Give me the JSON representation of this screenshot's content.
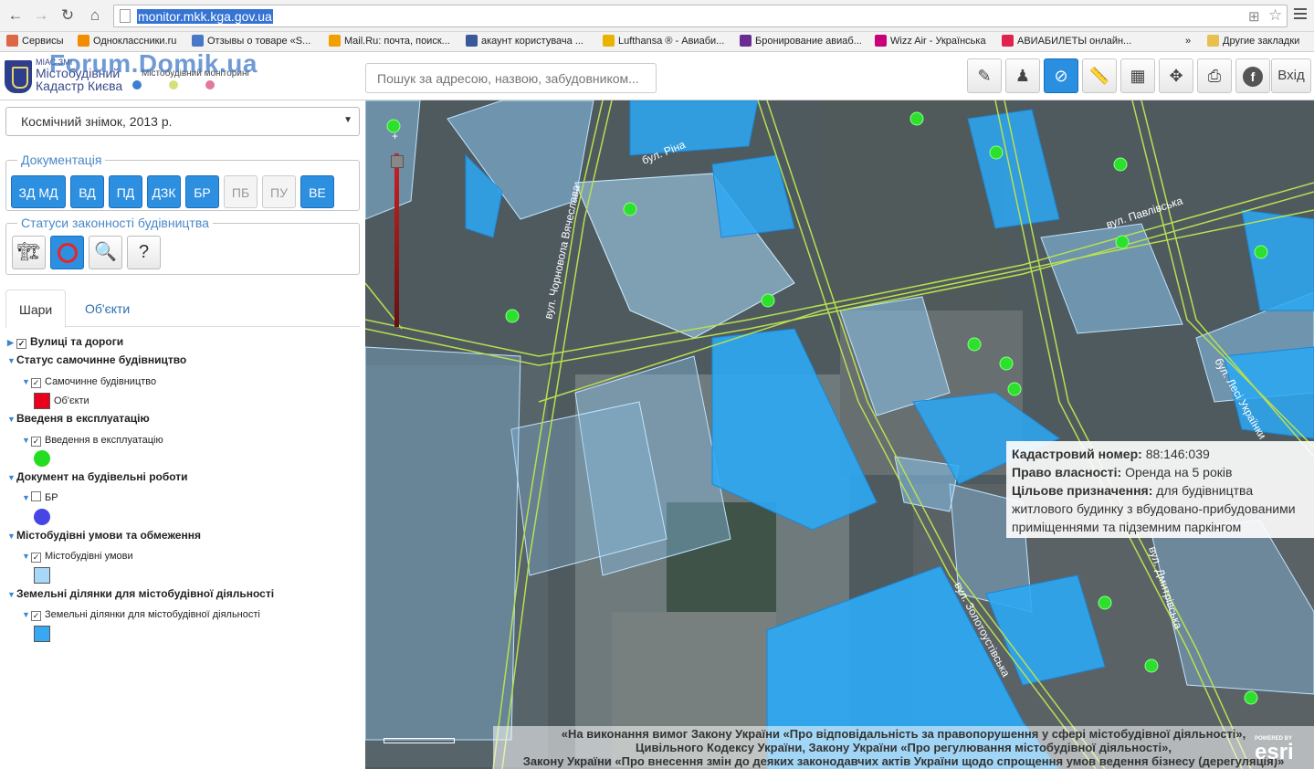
{
  "browser": {
    "url": "monitor.mkk.kga.gov.ua",
    "bookmarks": [
      {
        "label": "Сервисы",
        "color": "#d64",
        "icon": "apps-icon"
      },
      {
        "label": "Одноклассники.ru",
        "color": "#f28c00",
        "icon": "ok-icon"
      },
      {
        "label": "Отзывы о товаре «S...",
        "color": "#4a78c8",
        "icon": "doc-icon"
      },
      {
        "label": "Mail.Ru: почта, поиск...",
        "color": "#f0a000",
        "icon": "mail-icon"
      },
      {
        "label": "акаунт користувача ...",
        "color": "#3b5998",
        "icon": "dots-icon"
      },
      {
        "label": "Lufthansa ® - Авиаби...",
        "color": "#e8b400",
        "icon": "lufthansa-icon"
      },
      {
        "label": "Бронирование авиаб...",
        "color": "#6b2c91",
        "icon": "booking-icon"
      },
      {
        "label": "Wizz Air - Українська",
        "color": "#c8007a",
        "icon": "wizz-icon"
      },
      {
        "label": "АВИАБИЛЕТЫ онлайн...",
        "color": "#e0224c",
        "icon": "avia-icon"
      }
    ],
    "more": "»",
    "other_bookmarks": "Другие закладки"
  },
  "app": {
    "miac": "МІАС ЗМІ",
    "title_line1": "Містобудівний",
    "title_line2": "Кадастр Києва",
    "subtitle": "Містобудівний моніторинг",
    "watermark": "Forum.Domik.ua",
    "dots": [
      "#3a7fd0",
      "#d6e07a",
      "#e07a98"
    ],
    "search_placeholder": "Пошук за адресою, назвою, забудовником...",
    "exit_label": "Вхід",
    "tools": [
      {
        "name": "edit-tool-button",
        "icon": "✎",
        "active": false
      },
      {
        "name": "streetview-person-button",
        "icon": "♟",
        "active": false
      },
      {
        "name": "identify-compass-button",
        "icon": "⊘",
        "active": true
      },
      {
        "name": "measure-ruler-button",
        "icon": "📏",
        "active": false
      },
      {
        "name": "layers-grid-button",
        "icon": "▦",
        "active": false
      },
      {
        "name": "pan-move-button",
        "icon": "✥",
        "active": false
      },
      {
        "name": "print-button",
        "icon": "⎙",
        "active": false
      },
      {
        "name": "facebook-button",
        "icon": "f",
        "active": false
      }
    ]
  },
  "sidebar": {
    "basemap": "Космічний знімок, 2013 р.",
    "documentation_legend": "Документація",
    "doc_buttons": [
      {
        "label": "ЗД МД",
        "active": true
      },
      {
        "label": "ВД",
        "active": true
      },
      {
        "label": "ПД",
        "active": true
      },
      {
        "label": "ДЗК",
        "active": true
      },
      {
        "label": "БР",
        "active": true
      },
      {
        "label": "ПБ",
        "active": false
      },
      {
        "label": "ПУ",
        "active": false
      },
      {
        "label": "ВЕ",
        "active": true
      }
    ],
    "status_legend": "Статуси законності будівництва",
    "tabs": [
      "Шари",
      "Об'єкти"
    ],
    "tree": [
      {
        "type": "group",
        "label": "Вулиці та дороги",
        "checked": true
      },
      {
        "type": "group",
        "label": "Статус самочинне будівництво"
      },
      {
        "type": "layer",
        "label": "Самочинне будівництво",
        "checked": true
      },
      {
        "type": "legend",
        "label": "Об'єкти",
        "color": "#e8001c"
      },
      {
        "type": "group",
        "label": "Введеня в експлуатацію"
      },
      {
        "type": "layer",
        "label": "Введення в експлуатацію",
        "checked": true
      },
      {
        "type": "legend",
        "label": "",
        "color": "#22dd22"
      },
      {
        "type": "group",
        "label": "Документ на будівельні роботи"
      },
      {
        "type": "layer",
        "label": "БР",
        "checked": false
      },
      {
        "type": "legend",
        "label": "",
        "color": "#4646e6"
      },
      {
        "type": "group",
        "label": "Містобудівні умови та обмеження"
      },
      {
        "type": "layer",
        "label": "Містобудівні умови",
        "checked": true
      },
      {
        "type": "legend",
        "label": "",
        "color": "#a8d8f8"
      },
      {
        "type": "group",
        "label": "Земельні ділянки для містобудівної діяльності"
      },
      {
        "type": "layer",
        "label": "Земельні ділянки для містобудівної діяльності",
        "checked": true
      },
      {
        "type": "legend",
        "label": "",
        "color": "#3aa8f0"
      }
    ]
  },
  "map": {
    "streets": [
      "бул. Ріна",
      "вул. Павлівська",
      "вул. Чорновола Вячеслава",
      "бул. Лесі Українки",
      "вул. Дмитрівська",
      "вул. Золотоустівська"
    ],
    "popup": {
      "cad_label": "Кадастровий номер:",
      "cad_value": "88:146:039",
      "own_label": "Право власності:",
      "own_value": "Оренда на 5 років",
      "purpose_label": "Цільове призначення:",
      "purpose_value": "для будівництва житлового будинку з вбудовано-прибудованими приміщеннями та підземним паркінгом"
    },
    "attribution": [
      "«На виконання вимог Закону України «Про відповідальність за правопорушення у сфері містобудівної діяльності»,",
      "Цивільного Кодексу України, Закону України «Про регулювання містобудівної діяльності»,",
      "Закону України «Про внесення змін до деяких законодавчих актів України щодо спрощення умов ведення бізнесу (дерегуляція)»"
    ],
    "esri_powered": "POWERED BY",
    "esri": "esri"
  }
}
